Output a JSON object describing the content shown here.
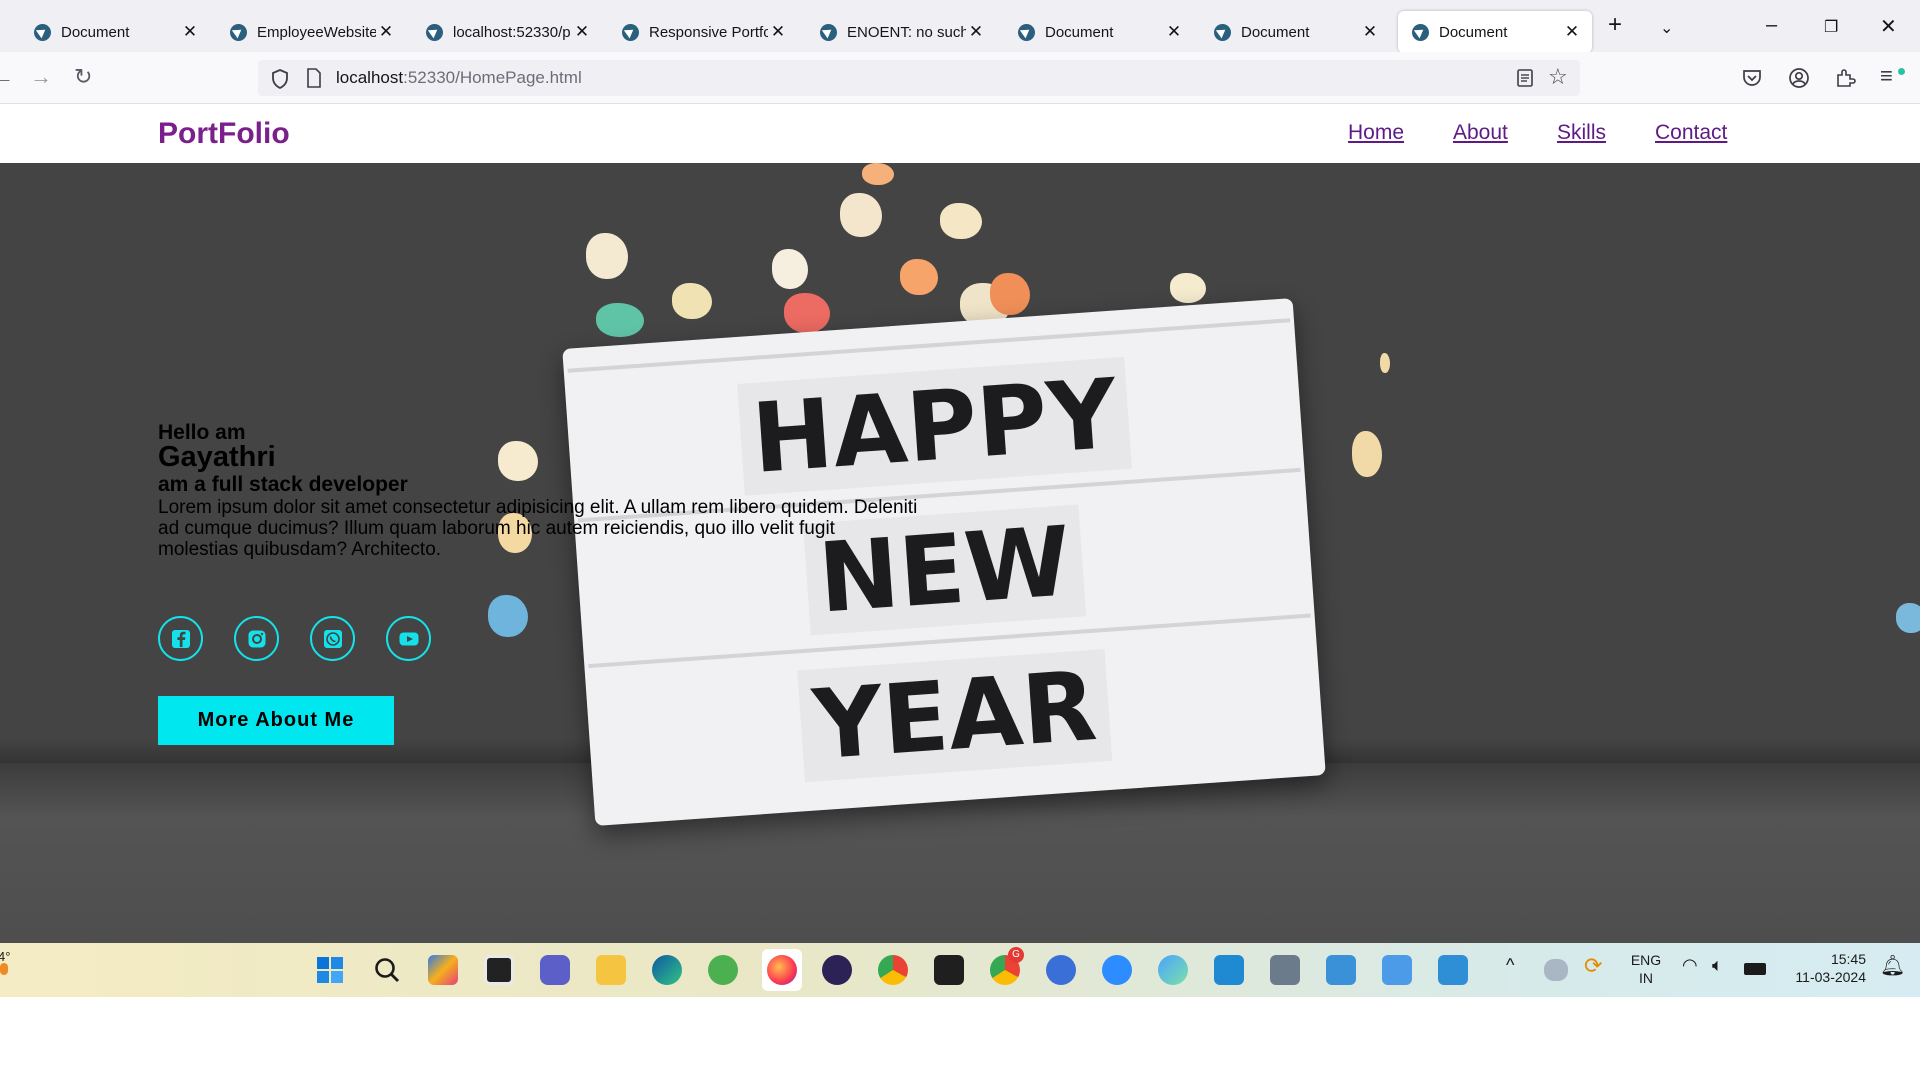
{
  "browser": {
    "tabs": [
      {
        "title": "Document",
        "active": false
      },
      {
        "title": "EmployeeWebsite",
        "active": false
      },
      {
        "title": "localhost:52330/p",
        "active": false
      },
      {
        "title": "Responsive Portfo",
        "active": false
      },
      {
        "title": "ENOENT: no such",
        "active": false
      },
      {
        "title": "Document",
        "active": false
      },
      {
        "title": "Document",
        "active": false
      },
      {
        "title": "Document",
        "active": true
      }
    ],
    "url_host": "localhost",
    "url_path": ":52330/HomePage.html"
  },
  "site": {
    "logo": "PortFolio",
    "nav": [
      "Home",
      "About",
      "Skills",
      "Contact"
    ]
  },
  "hero": {
    "greeting": "Hello am",
    "name": "Gayathri",
    "role": "am a full stack developer",
    "description": "Lorem ipsum dolor sit amet consectetur adipisicing elit. A ullam rem libero quidem. Deleniti ad cumque ducimus? Illum quam laborum hic autem reiciendis, quo illo velit fugit molestias quibusdam? Architecto.",
    "lightbox_lines": [
      "HAPPY",
      "NEW",
      "YEAR"
    ],
    "socials": [
      "facebook-icon",
      "instagram-icon",
      "whatsapp-icon",
      "youtube-icon"
    ],
    "cta_label": "More About Me"
  },
  "colors": {
    "accent": "#00e7ef",
    "logo": "#7b1f8c",
    "nav_link": "#5e1a86",
    "hero_bg": "#444444"
  },
  "taskbar": {
    "weather_temp": "4°",
    "lang_top": "ENG",
    "lang_bottom": "IN",
    "time": "15:45",
    "date": "11-03-2024",
    "chrome_badge": "G"
  }
}
